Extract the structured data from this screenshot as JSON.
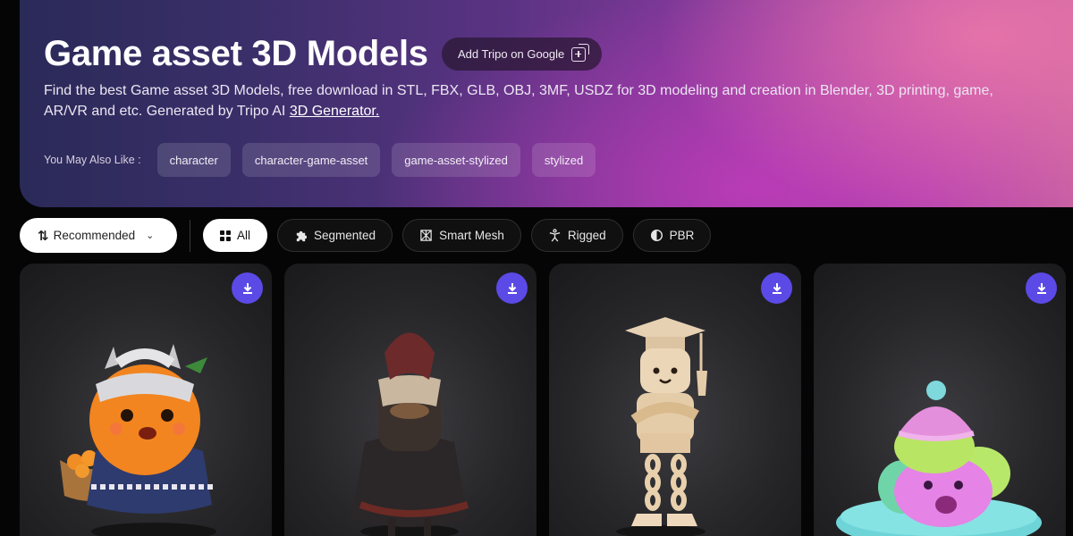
{
  "hero": {
    "title": "Game asset 3D Models",
    "google_button": "Add Tripo on Google",
    "description_part1": "Find the best Game asset 3D Models, free download in STL, FBX, GLB, OBJ, 3MF, USDZ for 3D modeling and creation in Blender, 3D printing, game,",
    "description_part2": "AR/VR and etc. Generated by Tripo AI ",
    "generator_link": "3D Generator.",
    "also_like_label": "You May Also Like :",
    "tags": [
      "character",
      "character-game-asset",
      "game-asset-stylized",
      "stylized"
    ]
  },
  "filters": {
    "sort_label": "Recommended",
    "chips": [
      {
        "label": "All",
        "icon": "grid-icon",
        "active": true
      },
      {
        "label": "Segmented",
        "icon": "puzzle-icon"
      },
      {
        "label": "Smart Mesh",
        "icon": "mesh-icon"
      },
      {
        "label": "Rigged",
        "icon": "figure-icon"
      },
      {
        "label": "PBR",
        "icon": "half-circle-icon"
      }
    ]
  },
  "cards": [
    {
      "subject": "orange character with silver headdress and fruit basket",
      "icon": "download-icon"
    },
    {
      "subject": "elderly woman in traditional dress holding bowl",
      "icon": "download-icon"
    },
    {
      "subject": "graduate scroll character with cap",
      "icon": "download-icon"
    },
    {
      "subject": "pink stylized creature with hat",
      "icon": "download-icon"
    }
  ],
  "colors": {
    "accent": "#5b4ae6",
    "background": "#050505"
  }
}
